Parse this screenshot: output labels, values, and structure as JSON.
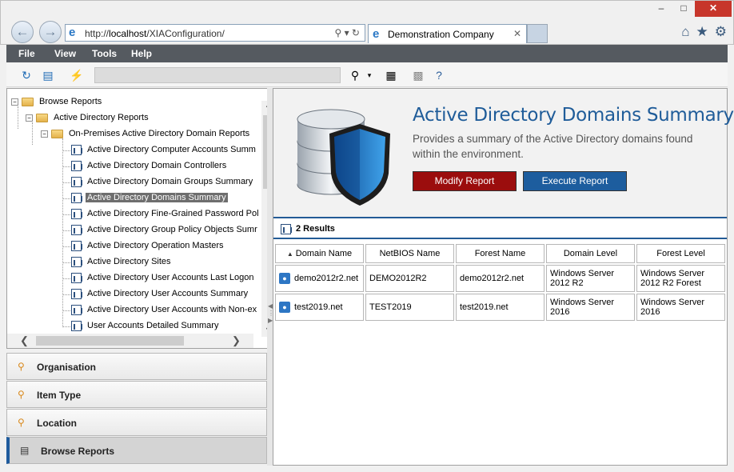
{
  "browser": {
    "url_prefix": "http://",
    "url_host": "localhost",
    "url_path": "/XIAConfiguration/",
    "tab_title": "Demonstration Company",
    "back_icon": "back-arrow-icon",
    "forward_icon": "forward-arrow-icon",
    "tools_glyphs": "⌕ ▾ ⟳"
  },
  "window": {
    "minimize": "–",
    "maximize": "□",
    "close": "✕"
  },
  "menu": {
    "file": "File",
    "view": "View",
    "tools": "Tools",
    "help": "Help"
  },
  "tree": {
    "root": "Browse Reports",
    "level1": "Active Directory Reports",
    "level2": "On-Premises Active Directory Domain Reports",
    "items": [
      "Active Directory Computer Accounts Summ",
      "Active Directory Domain Controllers",
      "Active Directory Domain Groups Summary",
      "Active Directory Domains Summary",
      "Active Directory Fine-Grained Password Pol",
      "Active Directory Group Policy Objects Sumr",
      "Active Directory Operation Masters",
      "Active Directory Sites",
      "Active Directory User Accounts Last Logon",
      "Active Directory User Accounts Summary",
      "Active Directory User Accounts with Non-ex",
      "User Accounts Detailed Summary"
    ],
    "selected_index": 3
  },
  "accordion": {
    "organisation": "Organisation",
    "item_type": "Item Type",
    "location": "Location",
    "browse_reports": "Browse Reports"
  },
  "report": {
    "title": "Active Directory Domains Summary",
    "description": "Provides a summary of the Active Directory domains found within the environment.",
    "modify_label": "Modify Report",
    "execute_label": "Execute Report",
    "results_count": "2 Results",
    "columns": [
      "Domain Name",
      "NetBIOS Name",
      "Forest Name",
      "Domain Level",
      "Forest Level"
    ],
    "rows": [
      [
        "demo2012r2.net",
        "DEMO2012R2",
        "demo2012r2.net",
        "Windows Server 2012 R2",
        "Windows Server 2012 R2 Forest"
      ],
      [
        "test2019.net",
        "TEST2019",
        "test2019.net",
        "Windows Server 2016",
        "Windows Server 2016"
      ]
    ]
  },
  "colors": {
    "menu_bar": "#555a60",
    "title_blue": "#1f5c99",
    "modify_button": "#9b0d0d",
    "execute_button": "#1d5d9e",
    "selected_row": "#6e6e6e",
    "accent_border": "#235b96"
  }
}
